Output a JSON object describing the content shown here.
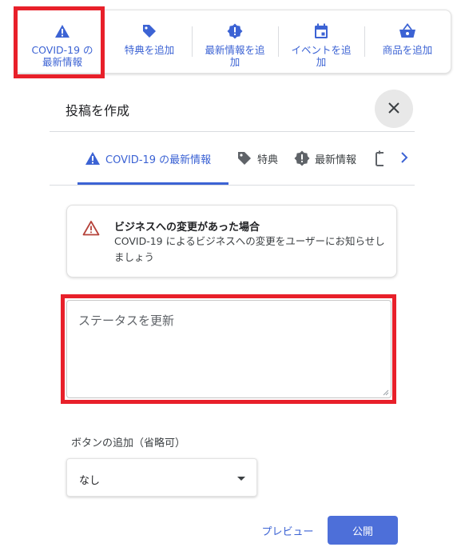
{
  "toolbar": {
    "items": [
      {
        "label": "COVID-19 の\n最新情報",
        "icon": "warning-triangle-icon"
      },
      {
        "label": "特典を追加",
        "icon": "tag-icon"
      },
      {
        "label": "最新情報を追\n加",
        "icon": "alert-badge-icon"
      },
      {
        "label": "イベントを追\n加",
        "icon": "calendar-icon"
      },
      {
        "label": "商品を追加",
        "icon": "shopping-basket-icon"
      }
    ]
  },
  "dialog": {
    "title": "投稿を作成",
    "close_icon": "close-icon"
  },
  "tabs": [
    {
      "label": "COVID-19 の最新情報",
      "icon": "warning-triangle-icon",
      "active": true
    },
    {
      "label": "特典",
      "icon": "tag-icon"
    },
    {
      "label": "最新情報",
      "icon": "alert-badge-icon"
    },
    {
      "label": "",
      "icon": "calendar-icon"
    }
  ],
  "tab_next_icon": "chevron-right-icon",
  "info_card": {
    "icon": "warning-outline-icon",
    "title": "ビジネスへの変更があった場合",
    "body": "COVID-19 によるビジネスへの変更をユーザーにお知らせしましょう"
  },
  "status": {
    "placeholder": "ステータスを更新"
  },
  "buttons_section": {
    "label": "ボタンの追加（省略可）",
    "selected": "なし"
  },
  "actions": {
    "preview": "プレビュー",
    "publish": "公開"
  },
  "colors": {
    "accent": "#3c63d4",
    "highlight": "#e8202a",
    "publish_bg": "#4d6fd9",
    "warning": "#b5423a"
  }
}
